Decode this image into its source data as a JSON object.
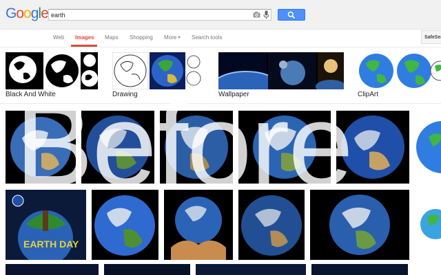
{
  "header": {
    "logo_letters": [
      {
        "ch": "G",
        "color": "#3b74d6"
      },
      {
        "ch": "o",
        "color": "#dd4b39"
      },
      {
        "ch": "o",
        "color": "#f4b400"
      },
      {
        "ch": "g",
        "color": "#3b74d6"
      },
      {
        "ch": "l",
        "color": "#0f9d58"
      },
      {
        "ch": "e",
        "color": "#dd4b39"
      }
    ],
    "search_value": "earth"
  },
  "nav": {
    "tabs": [
      "Web",
      "Images",
      "Maps",
      "Shopping",
      "More",
      "Search tools"
    ],
    "active_tab": "Images",
    "safesearch": "SafeSearch"
  },
  "related": [
    "Black And White",
    "Drawing",
    "Wallpaper",
    "ClipArt"
  ],
  "overlay_text": "Before",
  "colors": {
    "accent_red": "#dd4b39",
    "button_blue": "#4d90fe",
    "ocean": "#1f4fa8",
    "land": "#3b9b3b"
  }
}
